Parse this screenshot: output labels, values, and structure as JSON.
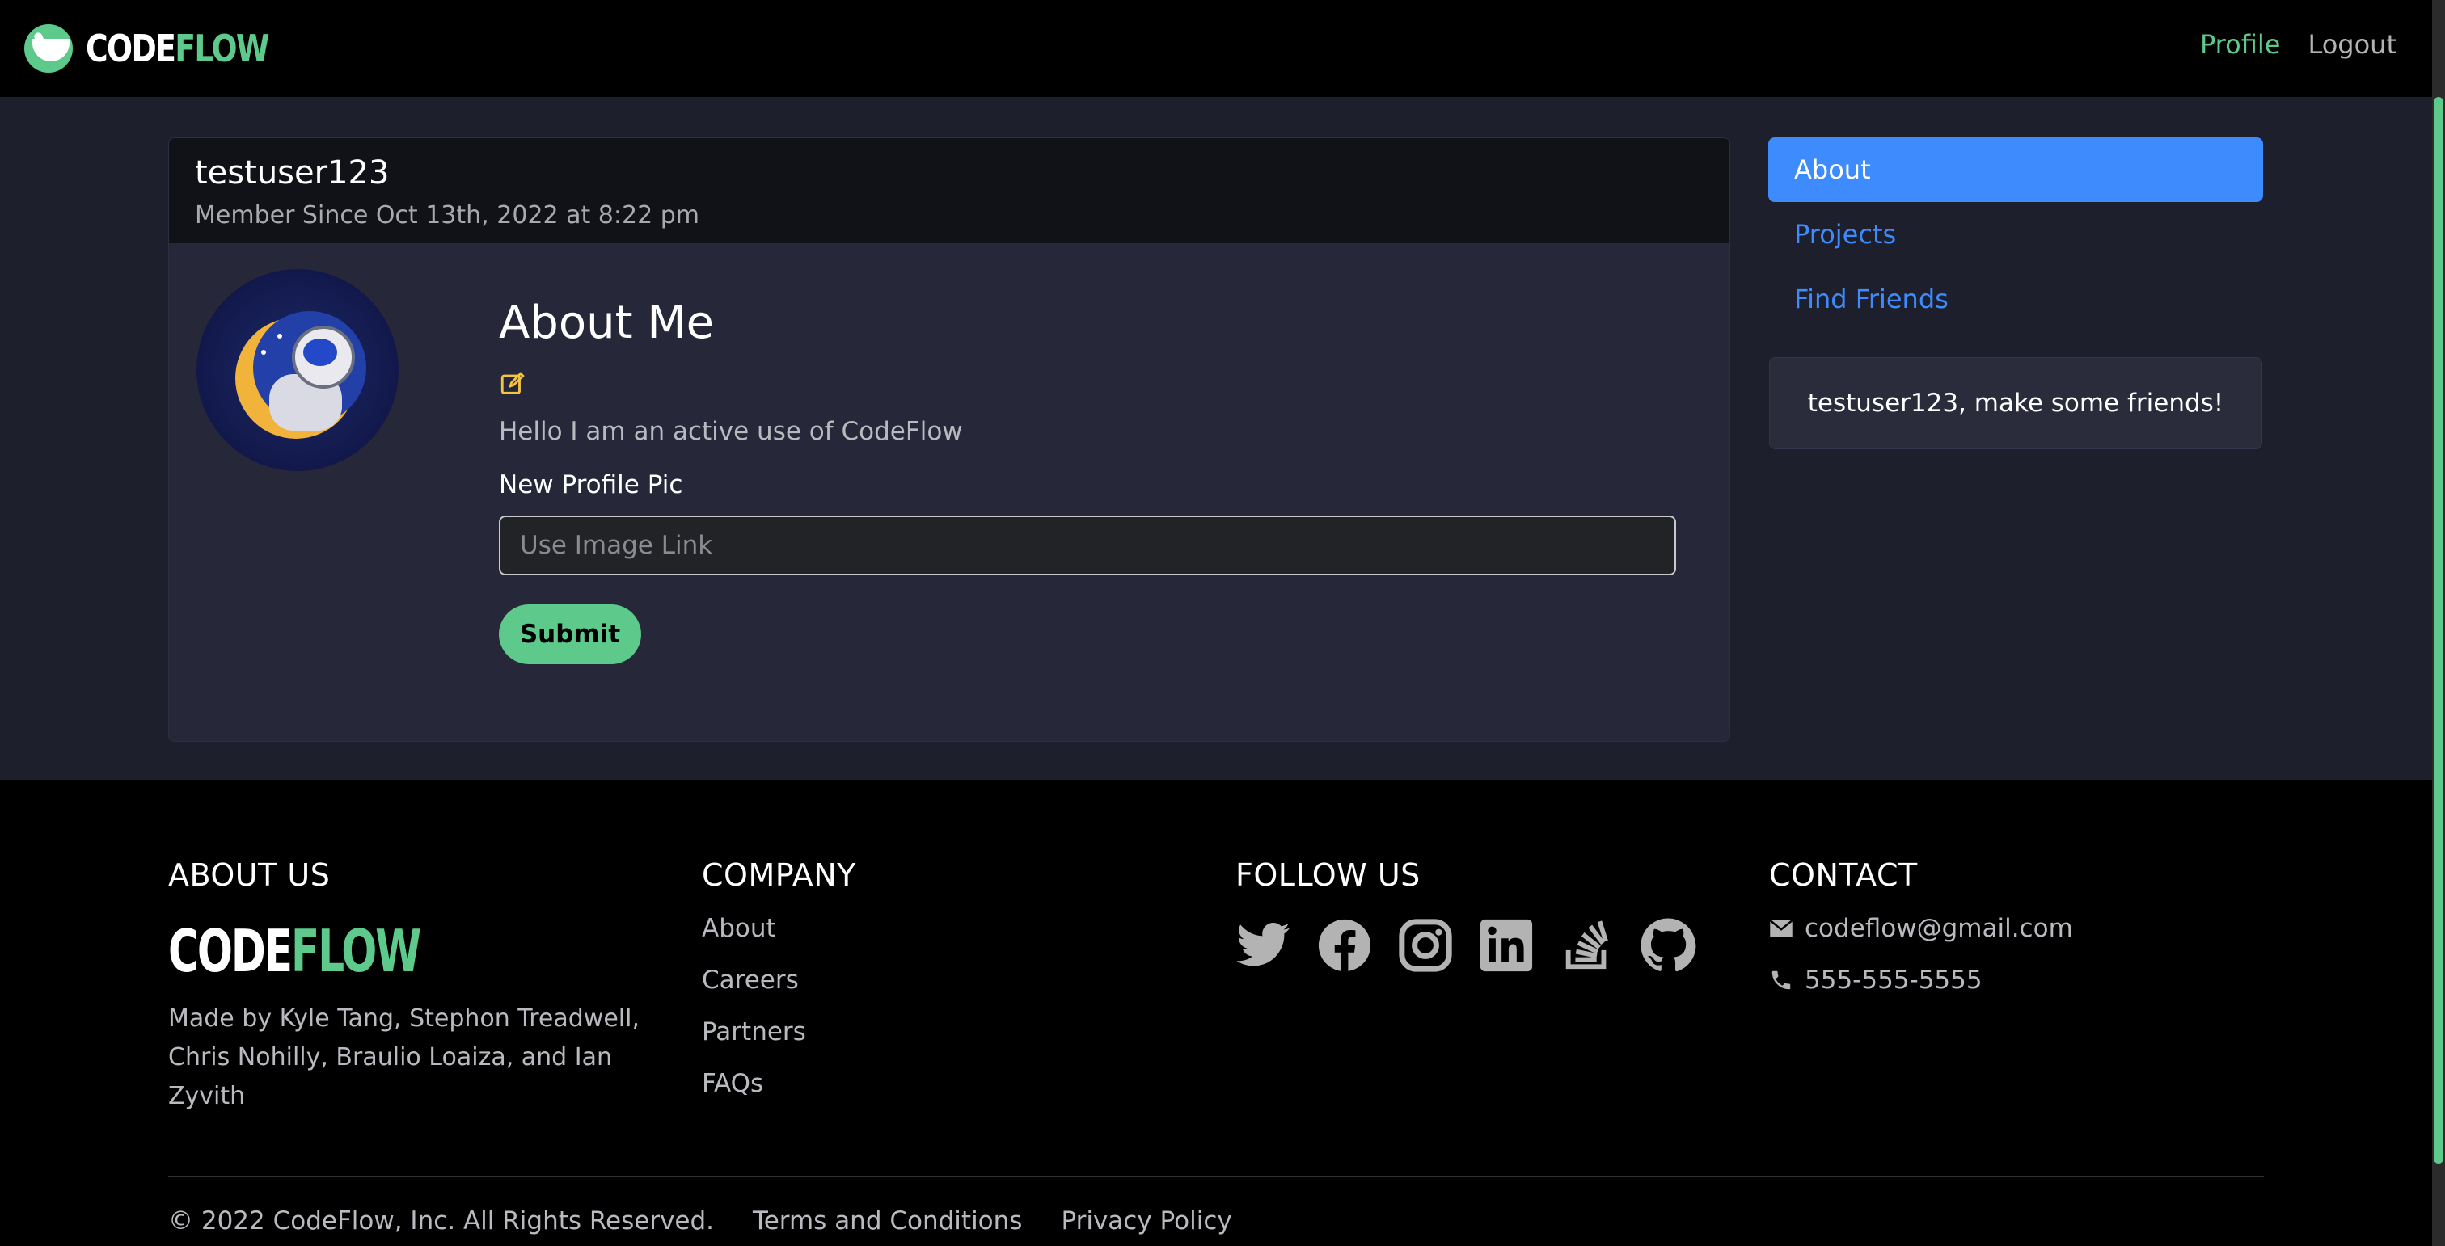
{
  "navbar": {
    "brand_part1": "CODE",
    "brand_part2": "FLOW",
    "profile": "Profile",
    "logout": "Logout"
  },
  "profile": {
    "username": "testuser123",
    "member_since": "Member Since Oct 13th, 2022 at 8:22 pm",
    "about_title": "About Me",
    "bio": "Hello I am an active use of CodeFlow",
    "new_pic_label": "New Profile Pic",
    "new_pic_placeholder": "Use Image Link",
    "submit": "Submit"
  },
  "sidebar": {
    "items": [
      {
        "label": "About",
        "active": true
      },
      {
        "label": "Projects",
        "active": false
      },
      {
        "label": "Find Friends",
        "active": false
      }
    ],
    "friends_message": "testuser123, make some friends!"
  },
  "footer": {
    "about_heading": "ABOUT US",
    "brand_part1": "CODE",
    "brand_part2": "FLOW",
    "about_text": "Made by Kyle Tang, Stephon Treadwell, Chris Nohilly, Braulio Loaiza, and Ian Zyvith",
    "company_heading": "COMPANY",
    "company_links": [
      "About",
      "Careers",
      "Partners",
      "FAQs"
    ],
    "follow_heading": "FOLLOW US",
    "social_icons": [
      "twitter-icon",
      "facebook-icon",
      "instagram-icon",
      "linkedin-icon",
      "stackoverflow-icon",
      "github-icon"
    ],
    "contact_heading": "CONTACT",
    "email": "codeflow@gmail.com",
    "phone": "555-555-5555",
    "copyright": "© 2022 CodeFlow, Inc. All Rights Reserved.",
    "terms": "Terms and Conditions",
    "privacy": "Privacy Policy"
  },
  "colors": {
    "accent_green": "#5dc98b",
    "accent_blue": "#3d8bfd",
    "page_bg": "#1e1f2c",
    "card_bg": "#262738"
  }
}
